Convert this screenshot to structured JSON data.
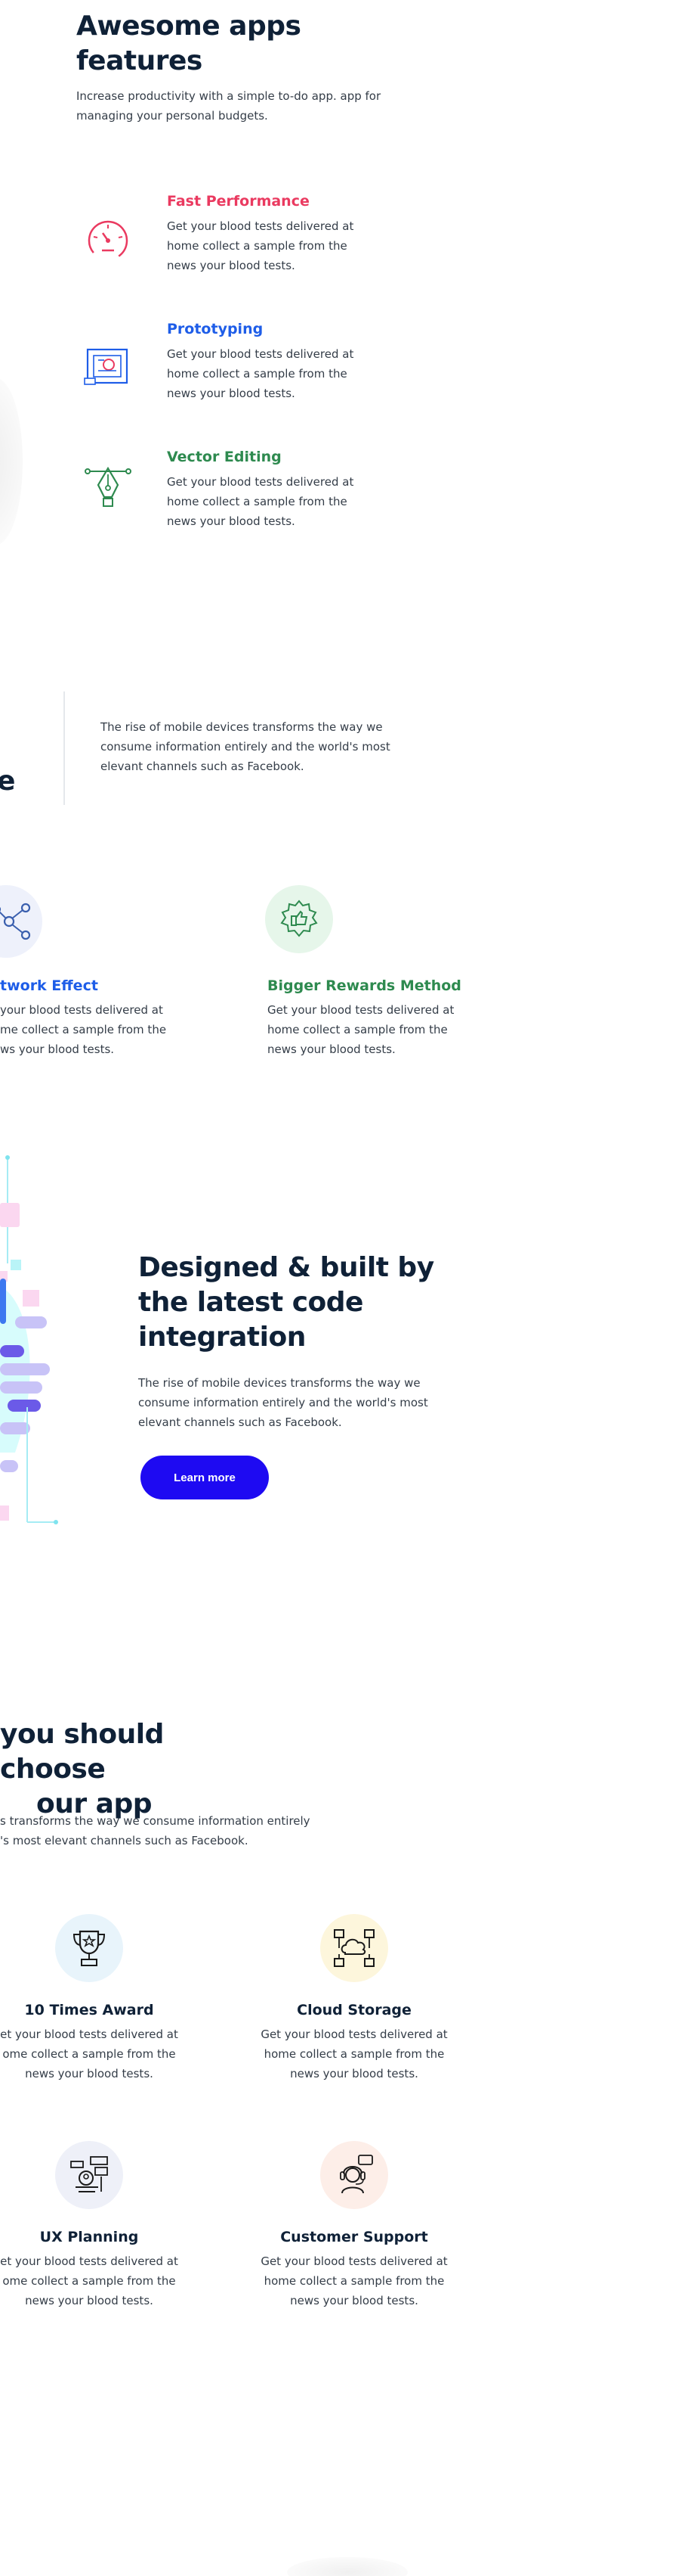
{
  "features_section": {
    "title_line1": "Awesome apps",
    "title_line2": "features",
    "description_line1": "Increase productivity with a simple to-do app. app for",
    "description_line2": "managing your personal budgets.",
    "items": [
      {
        "title": "Fast Performance",
        "color": "#ea3a60",
        "icon": "speedometer-icon",
        "lines": [
          "Get your blood tests delivered at",
          "home collect a sample from the",
          "news your blood tests."
        ]
      },
      {
        "title": "Prototyping",
        "color": "#1e5de8",
        "icon": "blueprint-icon",
        "lines": [
          "Get your blood tests delivered at",
          "home collect a sample from the",
          "news your blood tests."
        ]
      },
      {
        "title": "Vector Editing",
        "color": "#2e8a4f",
        "icon": "pen-tool-icon",
        "lines": [
          "Get your blood tests delivered at",
          "home collect a sample from the",
          "news your blood tests."
        ]
      }
    ]
  },
  "quote_section": {
    "fragment": "e",
    "lines": [
      "The rise of mobile devices transforms the way we",
      "consume information entirely and the world's most",
      "elevant channels such as Facebook."
    ]
  },
  "benefits": [
    {
      "title": "twork Effect",
      "color": "#1e5de8",
      "icon": "network-icon",
      "lines": [
        "your blood tests delivered at",
        "me collect a sample from the",
        "ws your blood tests."
      ]
    },
    {
      "title": "Bigger Rewards Method",
      "color": "#2e8a4f",
      "icon": "reward-badge-icon",
      "lines": [
        "Get your blood tests delivered at",
        "home collect a sample from the",
        "news your blood tests."
      ]
    }
  ],
  "integration": {
    "title_lines": [
      "Designed & built by",
      "the latest code",
      "integration"
    ],
    "lines": [
      "The rise of mobile devices transforms the way we",
      "consume information entirely and the world's most",
      "elevant channels such as Facebook."
    ],
    "button_label": "Learn more",
    "button_color": "#1e0af2"
  },
  "why_choose": {
    "title_line1": "you should choose",
    "title_line2": "our app",
    "desc_line1": "s transforms the way we consume information entirely",
    "desc_line2": "'s most elevant channels such as Facebook.",
    "cards": [
      {
        "title": "10 Times Award",
        "icon": "trophy-icon",
        "bg": "#e8f4fb",
        "lines": [
          "et your blood tests delivered at",
          "ome collect a sample from the",
          "news your blood tests."
        ]
      },
      {
        "title": "Cloud Storage",
        "icon": "cloud-network-icon",
        "bg": "#fdf6dc",
        "lines": [
          "Get your blood tests delivered at",
          "home collect a sample from the",
          "news your blood tests."
        ]
      },
      {
        "title": "UX Planning",
        "icon": "ux-planning-icon",
        "bg": "#eef0f8",
        "lines": [
          "et your blood tests delivered at",
          "ome collect a sample from the",
          "news your blood tests."
        ]
      },
      {
        "title": "Customer Support",
        "icon": "customer-support-icon",
        "bg": "#fdeee8",
        "lines": [
          "Get your blood tests delivered at",
          "home collect a sample from the",
          "news your blood tests."
        ]
      }
    ]
  }
}
